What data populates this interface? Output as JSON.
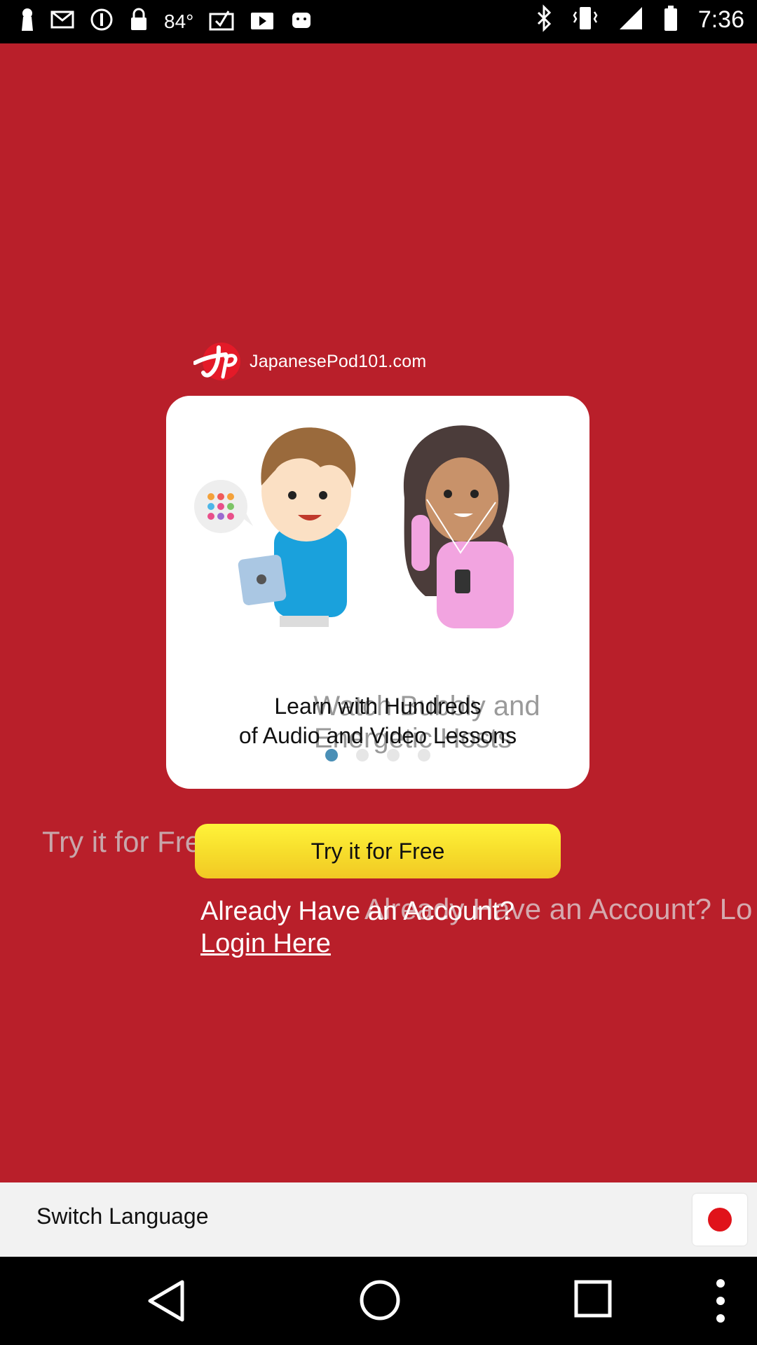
{
  "status_bar": {
    "temperature": "84°",
    "time": "7:36",
    "icons": [
      "keyhole-icon",
      "mail-icon",
      "info-icon",
      "lock-icon",
      "temp-text",
      "task-icon",
      "play-store-icon",
      "android-icon",
      "bluetooth-icon",
      "vibrate-icon",
      "signal-icon",
      "battery-icon"
    ]
  },
  "brand": {
    "name": "JapanesePod101.com"
  },
  "carousel": {
    "ghost_caption_line1": "Watch Bubbly and",
    "ghost_caption_line2": "Energetic Hosts",
    "caption_line1": "Learn with Hundreds",
    "caption_line2": "of Audio and Video Lessons",
    "page_count": 4,
    "active_page": 0
  },
  "cta": {
    "ghost_try": "Try it for Free",
    "try_label": "Try it for Free",
    "ghost_account": "Already Have an Account? Lo",
    "account_prompt": "Already Have an Account?",
    "login_label": "Login Here"
  },
  "language_bar": {
    "label": "Switch Language",
    "flag": "japan-flag",
    "flag_color": "#e0131a"
  },
  "colors": {
    "background": "#b91f2a",
    "button": "#f6dc2b",
    "active_dot": "#4a8fb6"
  }
}
